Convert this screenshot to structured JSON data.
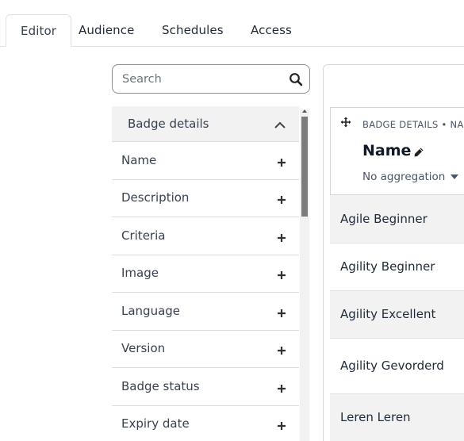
{
  "tabs": [
    {
      "label": "Editor",
      "active": true
    },
    {
      "label": "Audience",
      "active": false
    },
    {
      "label": "Schedules",
      "active": false
    },
    {
      "label": "Access",
      "active": false
    }
  ],
  "search": {
    "placeholder": "Search",
    "value": "",
    "icon": "search-icon"
  },
  "field_list": {
    "section_label": "Badge details",
    "section_expanded": true,
    "items": [
      {
        "label": "Name"
      },
      {
        "label": "Description"
      },
      {
        "label": "Criteria"
      },
      {
        "label": "Image"
      },
      {
        "label": "Language"
      },
      {
        "label": "Version"
      },
      {
        "label": "Badge status"
      },
      {
        "label": "Expiry date"
      }
    ]
  },
  "grid": {
    "column": {
      "breadcrumb": "BADGE DETAILS • NA",
      "name": "Name",
      "aggregation": "No aggregation"
    },
    "rows": [
      "Agile Beginner",
      "Agility Beginner",
      "Agility Excellent",
      "Agility Gevorderd",
      "Leren Leren"
    ]
  },
  "colors": {
    "row_alt": "#f2f2f2",
    "border": "#d6d6d6",
    "text": "#1f2937"
  }
}
